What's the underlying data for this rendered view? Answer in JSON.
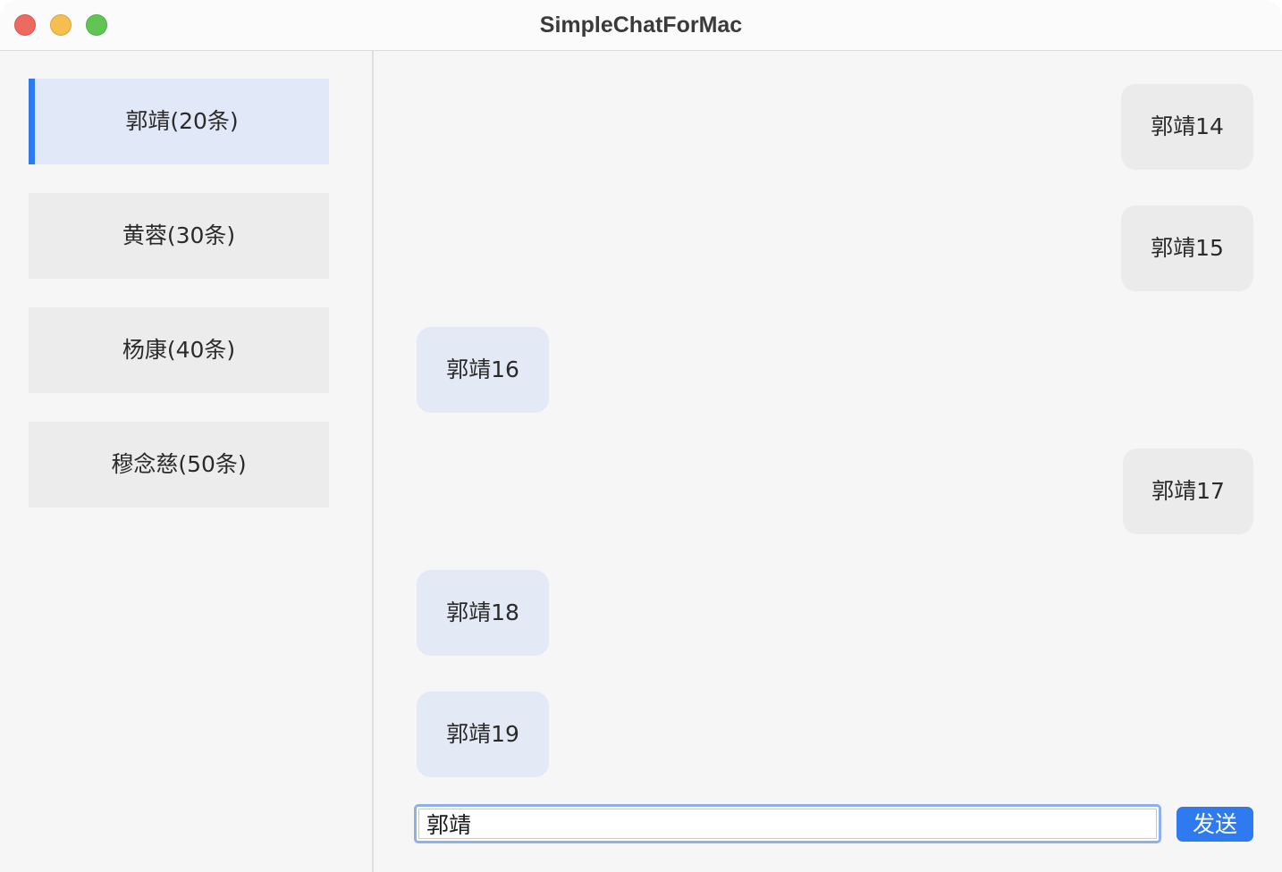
{
  "window": {
    "title": "SimpleChatForMac"
  },
  "sidebar": {
    "contacts": [
      {
        "label": "郭靖(20条)",
        "selected": true
      },
      {
        "label": "黄蓉(30条)",
        "selected": false
      },
      {
        "label": "杨康(40条)",
        "selected": false
      },
      {
        "label": "穆念慈(50条)",
        "selected": false
      }
    ]
  },
  "chat": {
    "messages": [
      {
        "text": "郭靖14",
        "side": "right"
      },
      {
        "text": "郭靖15",
        "side": "right"
      },
      {
        "text": "郭靖16",
        "side": "left"
      },
      {
        "text": "郭靖17",
        "side": "right"
      },
      {
        "text": "郭靖18",
        "side": "left"
      },
      {
        "text": "郭靖19",
        "side": "left"
      }
    ],
    "input": {
      "value": "郭靖",
      "placeholder": ""
    },
    "send_label": "发送"
  },
  "colors": {
    "accent": "#2f7af1",
    "selected_contact_bg": "#e1e8f7",
    "contact_bg": "#ececec",
    "bubble_left_bg": "#e4e9f6",
    "bubble_right_bg": "#ebebeb",
    "window_bg": "#f6f6f6"
  }
}
